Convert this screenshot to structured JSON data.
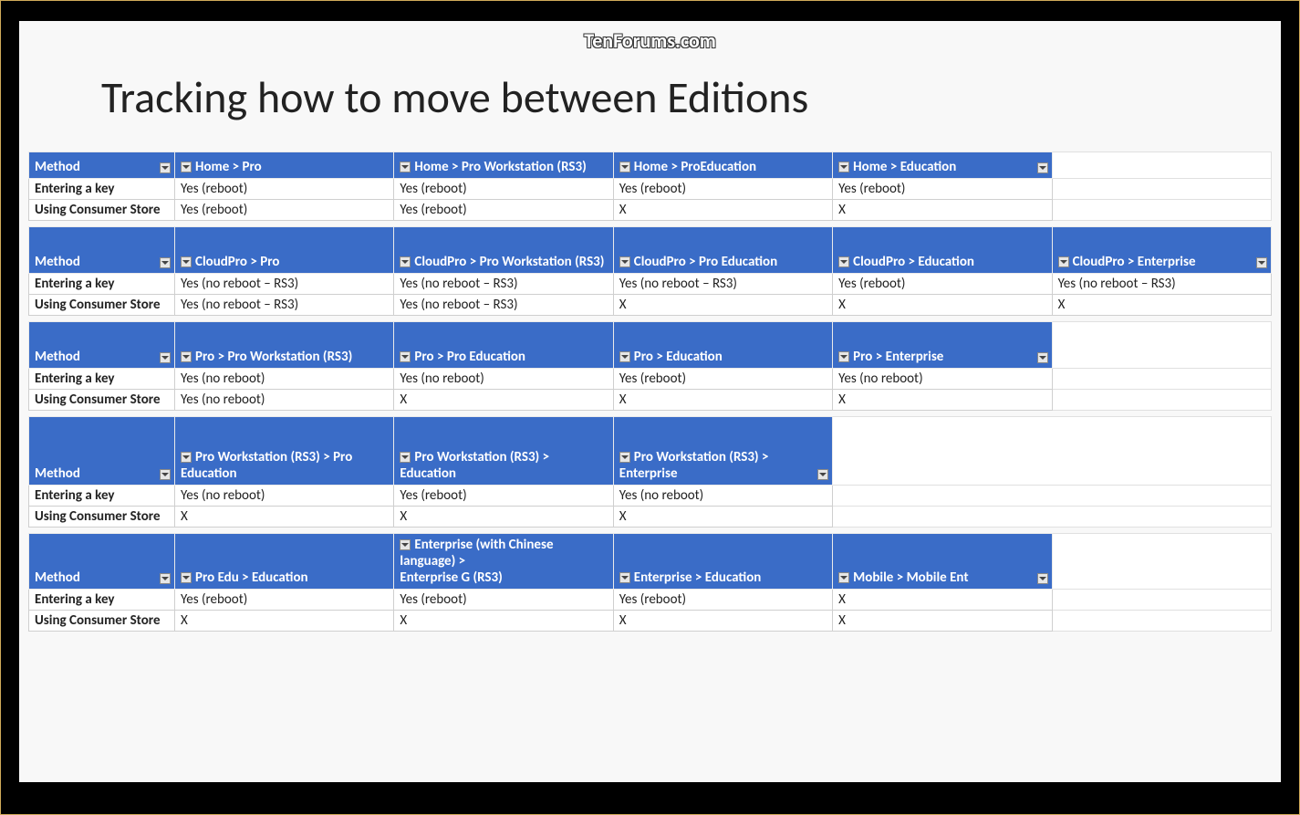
{
  "watermark": "TenForums.com",
  "title": "Tracking how to move between Editions",
  "labels": {
    "method": "Method",
    "enter_key": "Entering a key",
    "consumer_store": "Using Consumer Store"
  },
  "tables": [
    {
      "cols": 6,
      "header_height": "",
      "headers": [
        "Home > Pro",
        "Home > Pro Workstation (RS3)",
        "Home > ProEducation",
        "Home > Education",
        ""
      ],
      "right_filter_col": 4,
      "rows": [
        [
          "Yes (reboot)",
          "Yes (reboot)",
          "Yes (reboot)",
          "Yes (reboot)",
          ""
        ],
        [
          "Yes (reboot)",
          "Yes (reboot)",
          "X",
          "X",
          ""
        ]
      ]
    },
    {
      "cols": 6,
      "header_height": "mid",
      "headers": [
        "CloudPro > Pro",
        "CloudPro > Pro Workstation (RS3)",
        "CloudPro > Pro Education",
        "CloudPro > Education",
        "CloudPro > Enterprise"
      ],
      "right_filter_col": 5,
      "rows": [
        [
          "Yes (no reboot – RS3)",
          "Yes (no reboot – RS3)",
          "Yes (no reboot – RS3)",
          "Yes (reboot)",
          "Yes (no reboot – RS3)"
        ],
        [
          "Yes (no reboot – RS3)",
          "Yes (no reboot – RS3)",
          "X",
          "X",
          "X"
        ]
      ]
    },
    {
      "cols": 6,
      "header_height": "mid",
      "headers": [
        "Pro > Pro Workstation (RS3)",
        "Pro > Pro Education",
        "Pro > Education",
        "Pro > Enterprise",
        ""
      ],
      "right_filter_col": 4,
      "rows": [
        [
          "Yes (no reboot)",
          "Yes (no reboot)",
          "Yes (reboot)",
          "Yes (no reboot)",
          ""
        ],
        [
          "Yes (no reboot)",
          "X",
          "X",
          "X",
          ""
        ]
      ]
    },
    {
      "cols": 4,
      "header_height": "tall",
      "headers": [
        "Pro Workstation (RS3) > Pro Education",
        "Pro Workstation (RS3) > Education",
        "Pro Workstation (RS3) > Enterprise"
      ],
      "right_filter_col": 3,
      "rows": [
        [
          "Yes (no reboot)",
          "Yes (reboot)",
          "Yes (no reboot)"
        ],
        [
          "X",
          "X",
          "X"
        ]
      ],
      "rest_cols": 2
    },
    {
      "cols": 6,
      "header_height": "",
      "headers": [
        "Pro Edu > Education",
        "Enterprise (with Chinese language) > Enterprise G (RS3)",
        "Enterprise > Education",
        "Mobile > Mobile Ent",
        ""
      ],
      "right_filter_col": 4,
      "rows": [
        [
          "Yes (reboot)",
          "Yes (reboot)",
          "Yes (reboot)",
          "X",
          ""
        ],
        [
          "X",
          "X",
          "X",
          "X",
          ""
        ]
      ]
    }
  ]
}
